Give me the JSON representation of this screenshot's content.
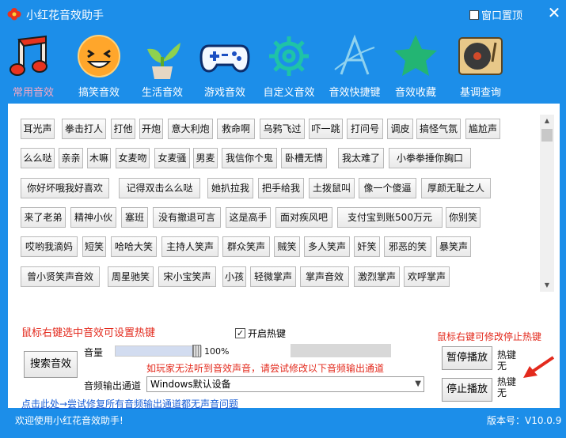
{
  "window": {
    "title": "小红花音效助手",
    "pin_label": "窗口置顶",
    "close_glyph": "✕"
  },
  "nav": [
    {
      "label": "常用音效",
      "icon": "music-note-icon",
      "active": true
    },
    {
      "label": "搞笑音效",
      "icon": "laughing-face-icon"
    },
    {
      "label": "生活音效",
      "icon": "plant-icon"
    },
    {
      "label": "游戏音效",
      "icon": "gamepad-icon"
    },
    {
      "label": "自定义音效",
      "icon": "gear-icon"
    },
    {
      "label": "音效快捷键",
      "icon": "hotkey-a-icon"
    },
    {
      "label": "音效收藏",
      "icon": "star-icon"
    },
    {
      "label": "基调查询",
      "icon": "turntable-icon"
    }
  ],
  "sounds": [
    "耳光声",
    "拳击打人",
    "打他",
    "开炮",
    "意大利炮",
    "救命啊",
    "乌鸦飞过",
    "吓一跳",
    "打问号",
    "调皮",
    "搞怪气氛",
    "尴尬声",
    "么么哒",
    "亲亲",
    "木嘛",
    "女麦吻",
    "女麦骚",
    "男麦",
    "我信你个鬼",
    "卧槽无情",
    "我太难了",
    "小拳拳捶你胸口",
    "你好坏哦我好喜欢",
    "记得双击么么哒",
    "她扒拉我",
    "把手给我",
    "土拨鼠叫",
    "像一个傻逼",
    "厚颜无耻之人",
    "来了老弟",
    "精神小伙",
    "塞班",
    "没有撤退可言",
    "这是高手",
    "面对疾风吧",
    "支付宝到账500万元",
    "你别笑",
    "哎哟我滴妈",
    "短笑",
    "哈哈大笑",
    "主持人笑声",
    "群众笑声",
    "贼笑",
    "多人笑声",
    "奸笑",
    "邪恶的笑",
    "暴笑声",
    "曾小贤笑声音效",
    "周星驰笑",
    "宋小宝笑声",
    "小孩",
    "轻微掌声",
    "掌声音效",
    "激烈掌声",
    "欢呼掌声"
  ],
  "controls": {
    "hint_left": "鼠标右键选中音效可设置热键",
    "hint_right": "鼠标右键可修改停止热键",
    "enable_hotkey": "开启热键",
    "enable_hotkey_checked": true,
    "volume_label": "音量",
    "volume_value": "100%",
    "volume_fraction": 1.0,
    "search_button": "搜索音效",
    "warning": "如玩家无法听到音效声音，请尝试修改以下音频输出通道",
    "output_label": "音频输出通道",
    "output_value": "Windows默认设备",
    "pause_button": "暂停播放",
    "stop_button": "停止播放",
    "hotkey_label": "热键",
    "hotkey_none": "无",
    "fix_link": "点击此处→尝试修复所有音频输出通道都无声音问题"
  },
  "status": {
    "welcome": "欢迎使用小红花音效助手!",
    "version": "版本号：V10.0.9"
  },
  "colors": {
    "window_bg": "#1c8ee9",
    "active_tab": "#f7a8c4",
    "hint_red": "#e32a1d",
    "link_blue": "#1a5fd6"
  }
}
